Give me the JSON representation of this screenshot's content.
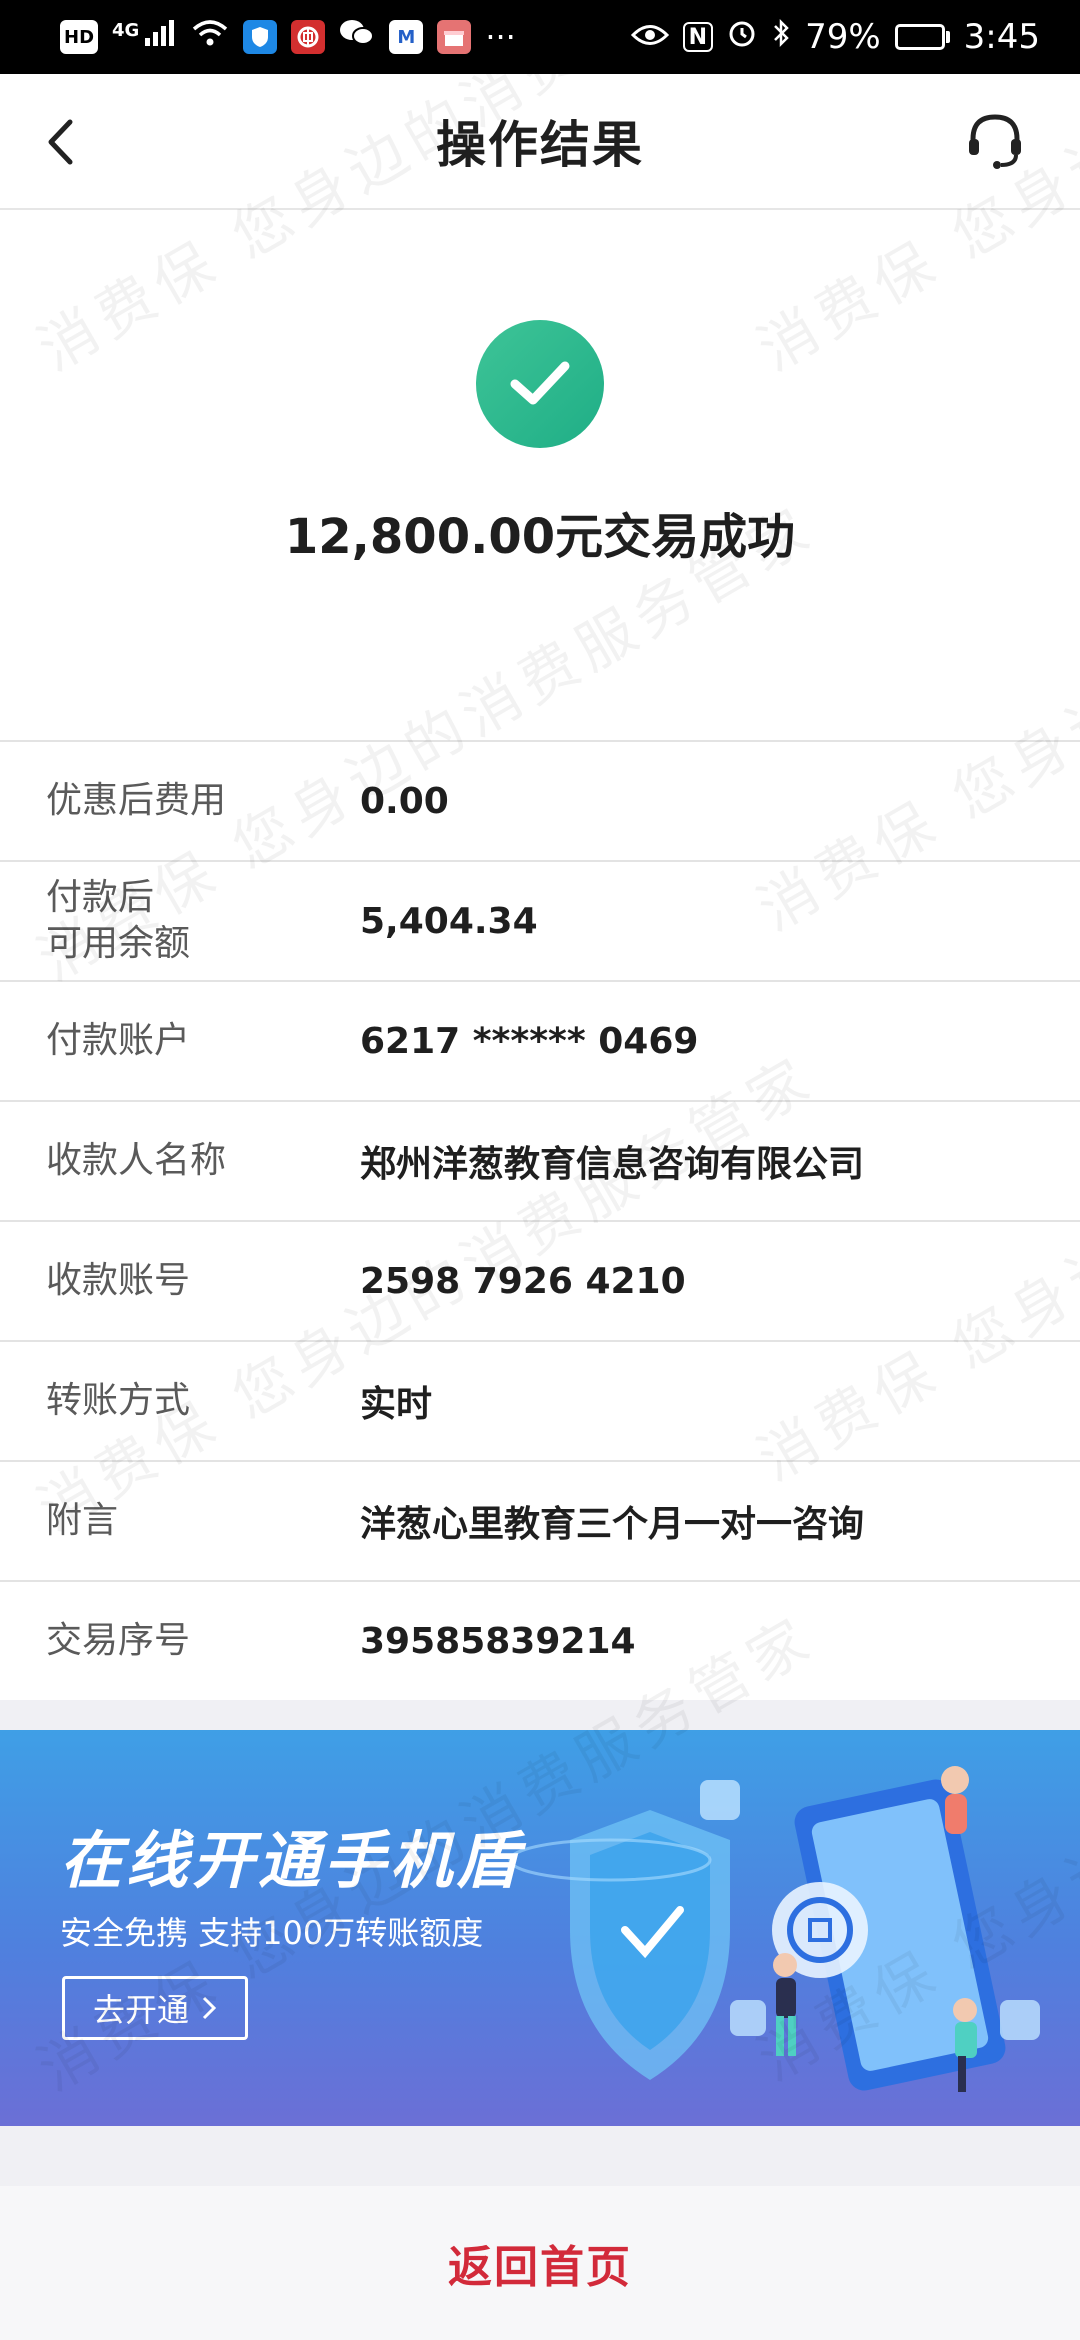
{
  "status_bar": {
    "icons_left": [
      "hd-icon",
      "4g-signal-icon",
      "wifi-icon",
      "shield-app-icon",
      "bank-app-icon",
      "wechat-icon",
      "mail-app-icon",
      "gift-app-icon",
      "more-dots-icon"
    ],
    "hd": "HD",
    "signal_type": "4G",
    "more": "···",
    "nfc": "N",
    "battery_text": "79%",
    "battery_level": 0.79,
    "time": "3:45"
  },
  "header": {
    "title": "操作结果"
  },
  "result": {
    "message": "12,800.00元交易成功",
    "status_color": "#2cbb8f"
  },
  "details": [
    {
      "label": "优惠后费用",
      "value": "0.00"
    },
    {
      "label": "付款后\n可用余额",
      "value": "5,404.34"
    },
    {
      "label": "付款账户",
      "value": "6217 ****** 0469"
    },
    {
      "label": "收款人名称",
      "value": "郑州洋葱教育信息咨询有限公司"
    },
    {
      "label": "收款账号",
      "value": "2598 7926 4210"
    },
    {
      "label": "转账方式",
      "value": "实时"
    },
    {
      "label": "附言",
      "value": "洋葱心里教育三个月一对一咨询"
    },
    {
      "label": "交易序号",
      "value": "39585839214"
    }
  ],
  "banner": {
    "title": "在线开通手机盾",
    "subtitle": "安全免携 支持100万转账额度",
    "button_label": "去开通"
  },
  "footer": {
    "home_label": "返回首页",
    "accent": "#d22a3a"
  },
  "watermark": {
    "text": "消费保 您身边的消费服务管家"
  }
}
